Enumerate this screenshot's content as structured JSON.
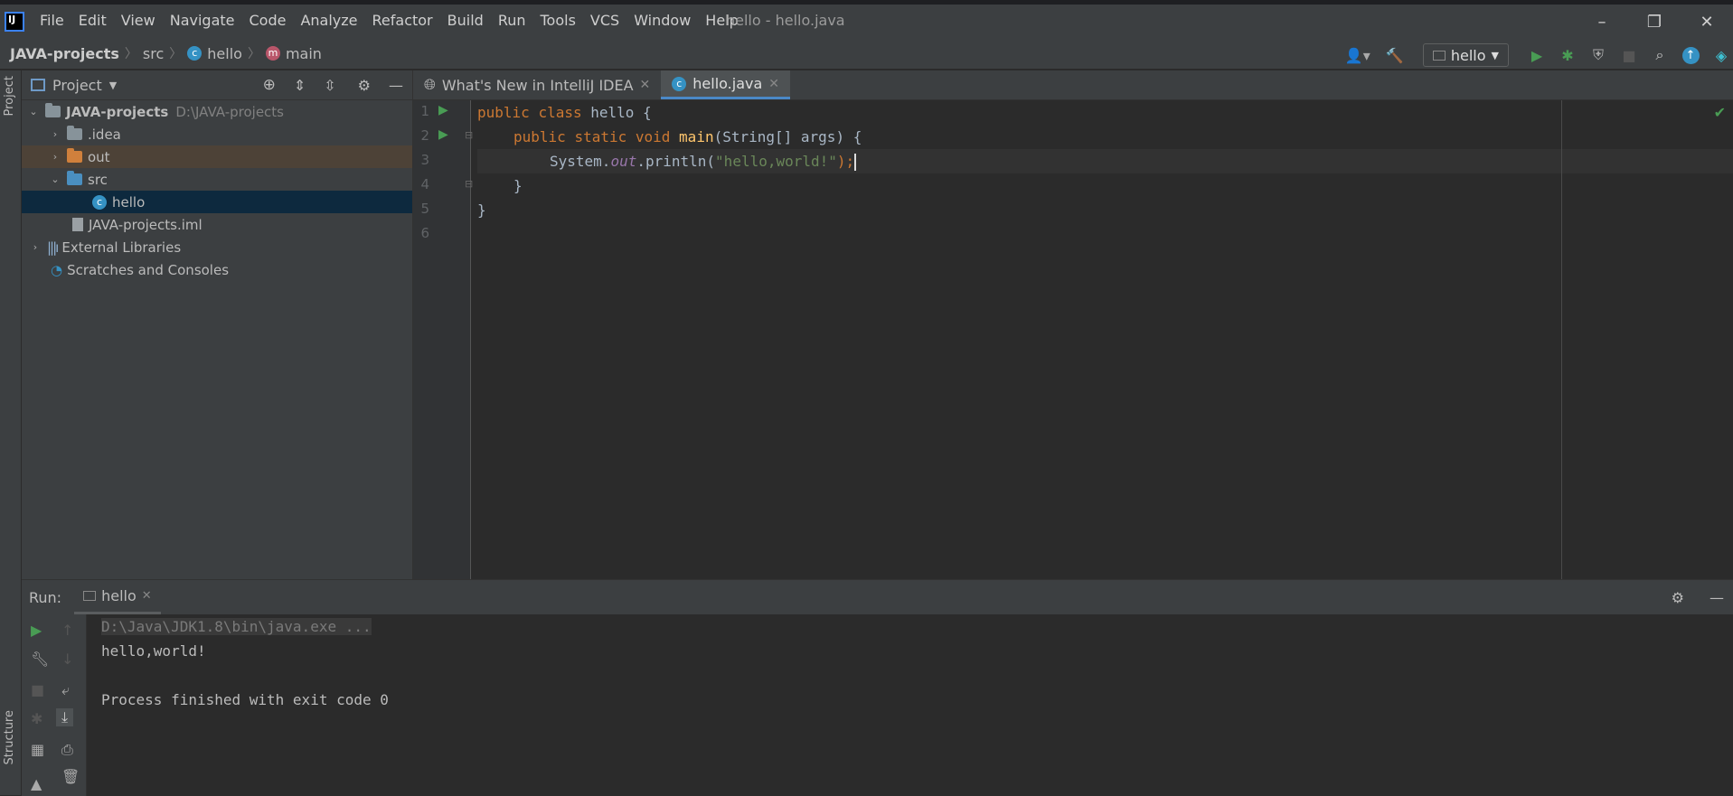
{
  "title_bar": {
    "window_title": "hello - hello.java",
    "menus": [
      "File",
      "Edit",
      "View",
      "Navigate",
      "Code",
      "Analyze",
      "Refactor",
      "Build",
      "Run",
      "Tools",
      "VCS",
      "Window",
      "Help"
    ],
    "controls": {
      "minimize": "–",
      "restore": "❐",
      "close": "✕"
    }
  },
  "breadcrumb": {
    "project": "JAVA-projects",
    "folder": "src",
    "class": "hello",
    "method": "main"
  },
  "toolbar": {
    "run_config": "hello"
  },
  "left_strip": {
    "project_label": "Project",
    "structure_label": "Structure"
  },
  "project_panel": {
    "title": "Project",
    "tree": [
      {
        "name": "JAVA-projects",
        "path": "D:\\JAVA-projects"
      },
      {
        "name": ".idea"
      },
      {
        "name": "out"
      },
      {
        "name": "src"
      },
      {
        "name": "hello"
      },
      {
        "name": "JAVA-projects.iml"
      },
      {
        "name": "External Libraries"
      },
      {
        "name": "Scratches and Consoles"
      }
    ]
  },
  "editor": {
    "tabs": [
      {
        "label": "What's New in IntelliJ IDEA"
      },
      {
        "label": "hello.java"
      }
    ],
    "line_numbers": [
      "1",
      "2",
      "3",
      "4",
      "5",
      "6"
    ],
    "code": {
      "l1_kw1": "public",
      "l1_kw2": "class",
      "l1_name": " hello {",
      "l2_kw1": "public",
      "l2_kw2": "static",
      "l2_kw3": "void",
      "l2_fn": "main",
      "l2_rest": "(String[] args) {",
      "l3_a": "System.",
      "l3_field": "out",
      "l3_b": ".println(",
      "l3_str": "\"hello,world!\"",
      "l3_c": ");",
      "l4": "}",
      "l5": "}"
    }
  },
  "run_panel": {
    "label": "Run:",
    "tab": "hello",
    "console": [
      "D:\\Java\\JDK1.8\\bin\\java.exe ...",
      "hello,world!",
      "",
      "Process finished with exit code 0"
    ]
  },
  "colors": {
    "accent": "#4a88c7",
    "run_green": "#499c54",
    "keyword": "#cc7832",
    "string": "#6a8759"
  }
}
